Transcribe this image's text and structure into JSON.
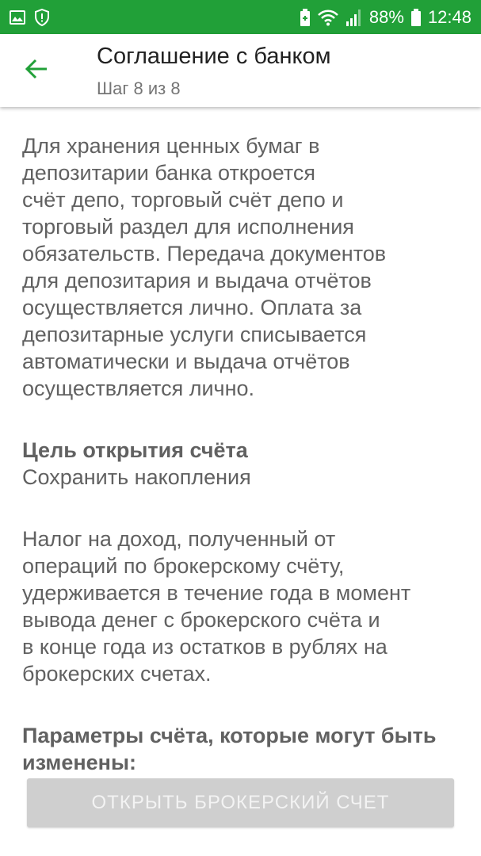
{
  "status_bar": {
    "battery_percent": "88%",
    "time": "12:48",
    "icons": [
      "image-icon",
      "shield-icon",
      "battery-saver-icon",
      "wifi-icon",
      "signal-icon",
      "battery-icon"
    ],
    "background": "#21a038"
  },
  "header": {
    "title": "Соглашение с банком",
    "subtitle": "Шаг 8 из 8",
    "back_icon": "arrow-left-icon",
    "accent": "#21a038"
  },
  "content": {
    "depository_text": "Для хранения ценных бумаг в\nдепозитарии банка откроется\nсчёт депо, торговый счёт депо и\nторговый раздел для исполнения\nобязательств. Передача документов\nдля депозитария и выдача отчётов\nосуществляется лично. Оплата за\nдепозитарные услуги списывается\nавтоматически и выдача отчётов\nосуществляется лично.",
    "purpose_heading": "Цель открытия счёта",
    "purpose_value": "Сохранить накопления",
    "tax_text": "Налог на доход, полученный от\nопераций по брокерскому счёту,\nудерживается в течение года в момент\nвывода денег с брокерского счёта и\nв конце года из остатков в рублях на\nброкерских счетах.",
    "params_heading": "Параметры счёта, которые могут быть\nизменены:"
  },
  "footer": {
    "open_button_label": "ОТКРЫТЬ БРОКЕРСКИЙ СЧЕТ",
    "button_color": "#cfcfcf"
  }
}
